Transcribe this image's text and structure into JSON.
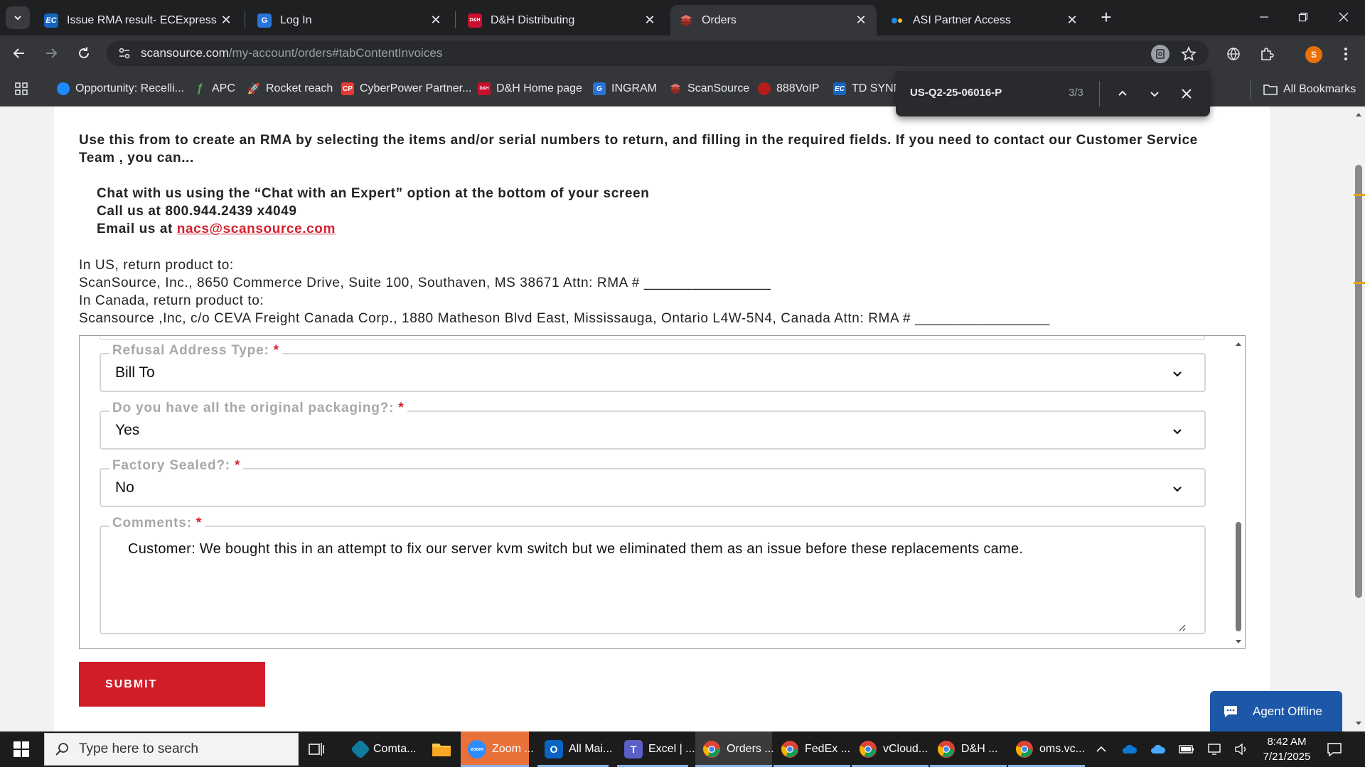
{
  "browser": {
    "tabs": [
      {
        "title": "Issue RMA result- ECExpress - T",
        "favicon": "EC",
        "favicon_color": "#1565c0",
        "active": false
      },
      {
        "title": "Log In",
        "favicon": "G",
        "favicon_color": "#2a73d9",
        "active": false
      },
      {
        "title": "D&H Distributing",
        "favicon": "D&H",
        "favicon_color": "#c8102e",
        "active": false
      },
      {
        "title": "Orders",
        "favicon": "scansource-icon",
        "favicon_color": "#c0392b",
        "active": true
      },
      {
        "title": "ASI Partner Access",
        "favicon": "asi-icon",
        "favicon_color": "#1e88e5",
        "active": false
      }
    ],
    "url_host": "scansource.com",
    "url_path": "/my-account/orders#tabContentInvoices",
    "profile_initial": "S",
    "bookmarks": [
      {
        "label": "Opportunity: Recelli...",
        "favicon_color": "#1a8cff"
      },
      {
        "label": "APC",
        "favicon_color": "#2e7d32"
      },
      {
        "label": "Rocket reach",
        "favicon_color": "#5c6bc0"
      },
      {
        "label": "CyberPower Partner...",
        "favicon": "CP",
        "favicon_color": "#e53935"
      },
      {
        "label": "D&H Home page",
        "favicon": "D&H",
        "favicon_color": "#c8102e"
      },
      {
        "label": "INGRAM",
        "favicon": "G",
        "favicon_color": "#2a73d9"
      },
      {
        "label": "ScanSource",
        "favicon_color": "#c0392b"
      },
      {
        "label": "888VoIP",
        "favicon_color": "#b71c1c"
      },
      {
        "label": "TD SYNN",
        "favicon": "EC",
        "favicon_color": "#1565c0"
      }
    ],
    "all_bookmarks_label": "All Bookmarks",
    "find": {
      "query": "US-Q2-25-06016-P",
      "count": "3/3"
    }
  },
  "page": {
    "intro": "Use this from to create an RMA by selecting the items and/or serial numbers to return, and filling in the required fields. If you need to contact our Customer Service Team , you can...",
    "contact_chat": "Chat with us using the “Chat with an Expert” option at the bottom of your screen",
    "contact_call": "Call us at 800.944.2439 x4049",
    "contact_email_prefix": "Email us at ",
    "contact_email": "nacs@scansource.com",
    "us_label": "In US, return product to:",
    "us_address": "ScanSource, Inc., 8650 Commerce Drive, Suite 100, Southaven, MS 38671 Attn: RMA # ________________",
    "ca_label": "In Canada, return product to:",
    "ca_address": "Scansource ,Inc, c/o CEVA Freight Canada Corp., 1880 Matheson Blvd East, Mississauga, Ontario L4W-5N4, Canada Attn: RMA # _________________",
    "form": {
      "refusal_label": "Refusal Address Type:",
      "refusal_value": "Bill To",
      "packaging_label": "Do you have all the original packaging?:",
      "packaging_value": "Yes",
      "sealed_label": "Factory Sealed?:",
      "sealed_value": "No",
      "comments_label": "Comments:",
      "comments_value": "Customer: We bought this in an attempt to fix our server kvm switch but we eliminated them as an issue before these replacements came.",
      "required_mark": "*"
    },
    "submit_label": "SUBMIT",
    "chat_widget_label": "Agent Offline"
  },
  "taskbar": {
    "search_placeholder": "Type here to search",
    "apps": [
      {
        "label": "Comta...",
        "icon_color": "#29b6f6"
      },
      {
        "label": "",
        "icon": "file-explorer-icon",
        "icon_color": "#f9a825"
      },
      {
        "label": "Zoom ...",
        "icon": "zoom",
        "icon_color": "#2d8cff"
      },
      {
        "label": "All Mai...",
        "icon": "O",
        "icon_color": "#0a64c2"
      },
      {
        "label": "Excel | ...",
        "icon": "teams-icon",
        "icon_color": "#5b5fc7"
      },
      {
        "label": "Orders ...",
        "icon": "chrome-icon",
        "icon_color": "#db4437"
      },
      {
        "label": "FedEx ...",
        "icon": "chrome-icon",
        "icon_color": "#db4437"
      },
      {
        "label": "vCloud...",
        "icon": "chrome-icon",
        "icon_color": "#db4437"
      },
      {
        "label": "D&H ...",
        "icon": "chrome-icon",
        "icon_color": "#db4437"
      },
      {
        "label": "oms.vc...",
        "icon": "chrome-icon",
        "icon_color": "#db4437"
      }
    ],
    "time": "8:42 AM",
    "date": "7/21/2025"
  },
  "colors": {
    "accent_red": "#d11d28",
    "chat_blue": "#1d58a8",
    "link_red": "#d4202e"
  }
}
